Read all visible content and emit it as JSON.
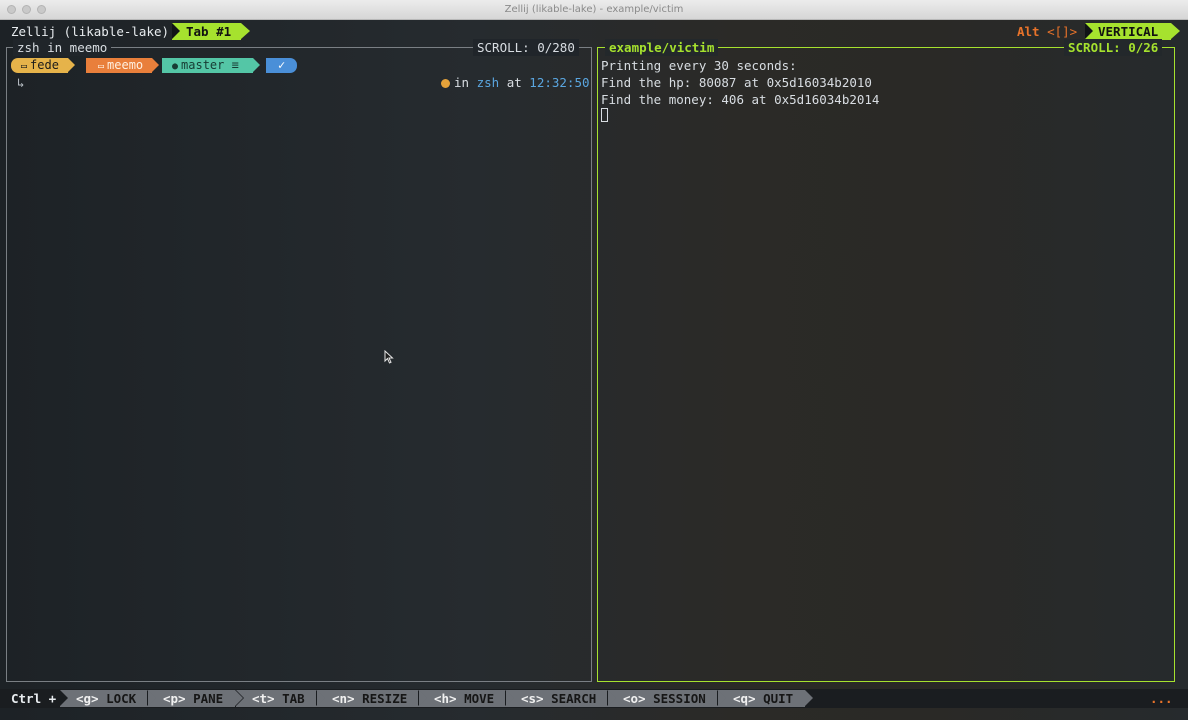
{
  "window": {
    "title": "Zellij (likable-lake) - example/victim"
  },
  "tabbar": {
    "session": "Zellij (likable-lake)",
    "active_tab": "Tab #1",
    "alt_label": "Alt",
    "alt_keys": "<[]>",
    "mode": "VERTICAL"
  },
  "left_pane": {
    "title": "zsh in meemo",
    "scroll_label": "SCROLL:",
    "scroll_value": "0/280",
    "prompt": {
      "user": "fede",
      "dir": "meemo",
      "branch": "master ≡",
      "status": "✓",
      "input_glyph": "↳",
      "rp_in": "in",
      "rp_shell": "zsh",
      "rp_at": "at",
      "rp_time": "12:32:50"
    }
  },
  "right_pane": {
    "title": "example/victim",
    "scroll_label": "SCROLL:",
    "scroll_value": "0/26",
    "lines": [
      "Printing every 30 seconds:",
      "Find the hp: 80087 at 0x5d16034b2010",
      "Find the money: 406 at 0x5d16034b2014"
    ]
  },
  "statusbar": {
    "modifier": "Ctrl +",
    "keys": [
      {
        "key": "<g>",
        "label": "LOCK"
      },
      {
        "key": "<p>",
        "label": "PANE"
      },
      {
        "key": "<t>",
        "label": "TAB"
      },
      {
        "key": "<n>",
        "label": "RESIZE"
      },
      {
        "key": "<h>",
        "label": "MOVE"
      },
      {
        "key": "<s>",
        "label": "SEARCH"
      },
      {
        "key": "<o>",
        "label": "SESSION"
      },
      {
        "key": "<q>",
        "label": "QUIT"
      }
    ],
    "more": "..."
  },
  "colors": {
    "accent": "#a6e22e",
    "alt_key": "#e8732a"
  }
}
